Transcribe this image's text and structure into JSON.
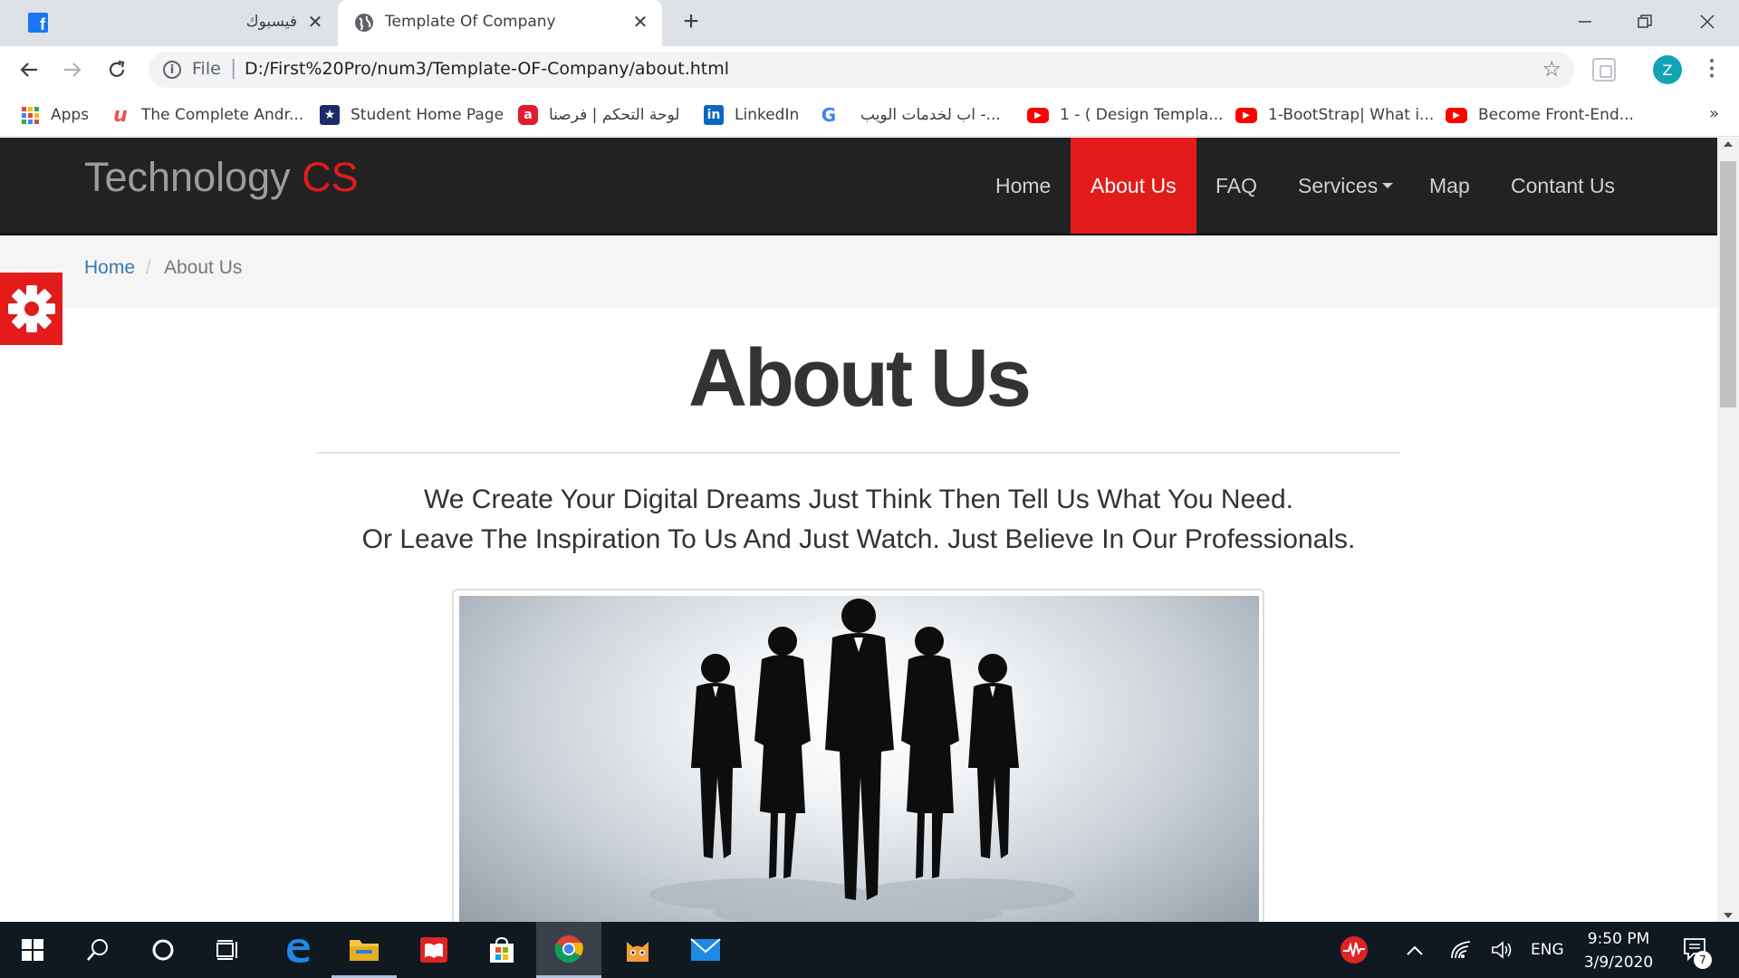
{
  "browser": {
    "tabs": [
      {
        "title": "فيسبوك",
        "favicon": "facebook-icon"
      },
      {
        "title": "Template Of Company",
        "favicon": "globe-icon"
      }
    ],
    "address": {
      "scheme": "File",
      "url": "D:/First%20Pro/num3/Template-OF-Company/about.html"
    },
    "profile_initial": "Z",
    "bookmarks": [
      {
        "label": "Apps",
        "icon": "apps-grid-icon"
      },
      {
        "label": "The Complete Andr...",
        "icon": "udemy-icon"
      },
      {
        "label": "Student Home Page",
        "icon": "star-badge-icon"
      },
      {
        "label": "لوحة التحكم | فرصنا",
        "icon": "forsa-icon"
      },
      {
        "label": "LinkedIn",
        "icon": "linkedin-icon"
      },
      {
        "label": "",
        "icon": "google-icon"
      },
      {
        "label": "اب لخدمات الويب -...",
        "icon": ""
      },
      {
        "label": "1 - ( Design Templa...",
        "icon": "youtube-icon"
      },
      {
        "label": "1-BootStrap| What i...",
        "icon": "youtube-icon"
      },
      {
        "label": "Become Front-End...",
        "icon": "youtube-icon"
      }
    ]
  },
  "site": {
    "brand": {
      "name": "Technology",
      "accent": "CS"
    },
    "nav": {
      "home": "Home",
      "about": "About Us",
      "faq": "FAQ",
      "services": "Services",
      "map": "Map",
      "contact": "Contant Us"
    },
    "breadcrumb": {
      "home": "Home",
      "separator": "/",
      "current": "About Us"
    },
    "title": "About Us",
    "intro_line1": "We Create Your Digital Dreams Just Think Then Tell Us What You Need.",
    "intro_line2": "Or Leave The Inspiration To Us And Just Watch. Just Believe In Our Professionals.",
    "colors": {
      "accent": "#e31b1b",
      "navbar": "#222222",
      "link": "#337ab7"
    }
  },
  "taskbar": {
    "language": "ENG",
    "time": "9:50 PM",
    "date": "3/9/2020",
    "notifications": "7"
  }
}
